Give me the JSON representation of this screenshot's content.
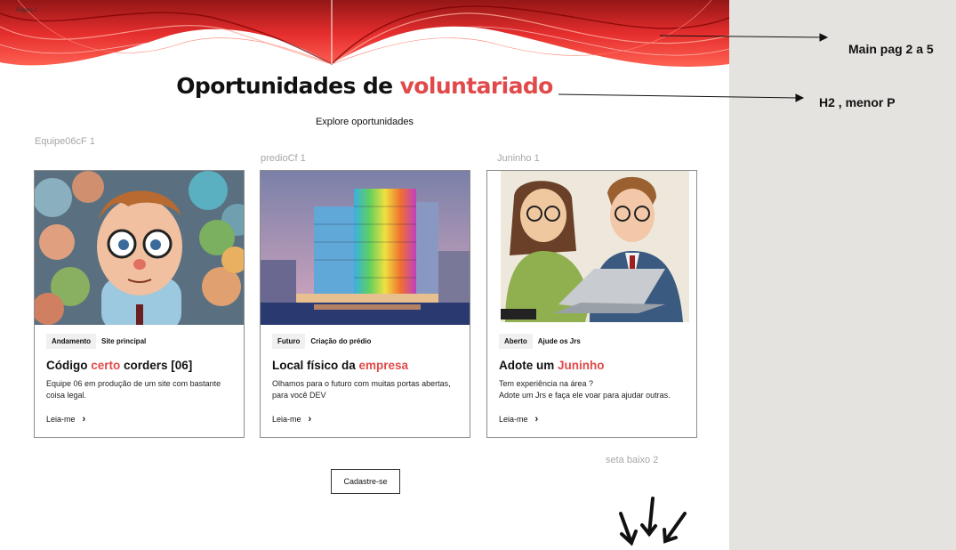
{
  "frame_label": "Página 2",
  "heading": {
    "text": "Oportunidades de ",
    "accent": "voluntariado"
  },
  "subtitle": "Explore oportunidades",
  "layer_labels": {
    "card1": "Equipe06cF 1",
    "card2": "predioCf 1",
    "card3": "Juninho 1",
    "arrows": "seta baixo 2"
  },
  "cards": [
    {
      "tag1": "Andamento",
      "tag2": "Site principal",
      "title_pre": "Código ",
      "title_accent": "certo",
      "title_post": " corders [06]",
      "desc": "Equipe 06 em produção de um site com bastante coisa legal.",
      "link": "Leia-me"
    },
    {
      "tag1": "Futuro",
      "tag2": "Criação do prédio",
      "title_pre": "Local físico da ",
      "title_accent": "empresa",
      "title_post": "",
      "desc": "Olhamos para o futuro com muitas portas abertas, para você DEV",
      "link": "Leia-me"
    },
    {
      "tag1": "Aberto",
      "tag2": "Ajude os Jrs",
      "title_pre": "Adote um ",
      "title_accent": "Juninho",
      "title_post": "",
      "desc_line1": "Tem experiência na área ?",
      "desc_line2": "Adote um Jrs e faça ele voar para ajudar outras.",
      "link": "Leia-me"
    }
  ],
  "cta_label": "Cadastre-se",
  "annotations": {
    "note1": "Main pag 2 a 5",
    "note2": "H2 , menor P"
  },
  "icons": {
    "link_arrow": "chevron-right-icon",
    "down_arrows": "arrow-down-icon"
  },
  "colors": {
    "accent": "#e04a4a",
    "ribbon": "#d91c1c",
    "canvas_bg": "#e5e3df"
  }
}
